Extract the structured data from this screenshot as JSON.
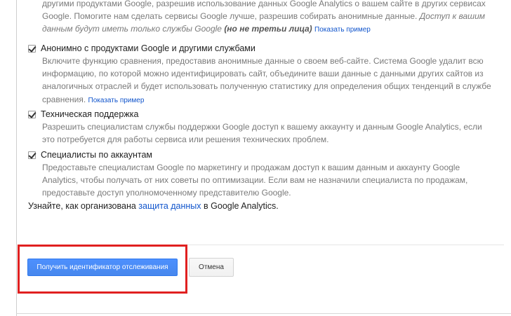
{
  "top_block": {
    "line1": "другими продуктами Google, разрешив использование данных Google Analytics о вашем сайте в других сервисах",
    "line2": "Google. Помогите нам сделать сервисы Google лучше, разрешив собирать анонимные данные.",
    "line2_italic": "Доступ к вашим",
    "line3_prefix": "данным будут иметь только службы Google",
    "line3_bold": "(но не третьи лица)",
    "example_link": "Показать пример"
  },
  "options": [
    {
      "title": "Анонимно с продуктами Google и другими службами",
      "checked": true,
      "desc_lines": [
        "Включите функцию сравнения, предоставив анонимные данные о своем веб-сайте. Система Google удалит всю",
        "информацию, по которой можно идентифицировать сайт, объедините ваши данные с данными других сайтов из",
        "аналогичных отраслей и будет использовать полученную статистику для определения общих тенденций в службе",
        "сравнения."
      ],
      "example_link": "Показать пример"
    },
    {
      "title": "Техническая поддержка",
      "checked": true,
      "desc_lines": [
        "Разрешить специалистам службы поддержки Google доступ к вашему аккаунту и данным Google Analytics, если",
        "это потребуется для работы сервиса или решения технических проблем."
      ]
    },
    {
      "title": "Специалисты по аккаунтам",
      "checked": true,
      "desc_lines": [
        "Предоставьте специалистам Google по маркетингу и продажам доступ к вашим данным и аккаунту Google",
        "Analytics, чтобы получать от них советы по оптимизации. Если вам не назначили специалиста по продажам,",
        "предоставьте доступ уполномоченному представителю Google."
      ]
    }
  ],
  "learn_more": {
    "prefix": "Узнайте, как организована",
    "link": "защита данных",
    "suffix": "в Google Analytics."
  },
  "buttons": {
    "primary": "Получить идентификатор отслеживания",
    "secondary": "Отмена"
  },
  "colors": {
    "primary_button": "#4d90fe",
    "highlight_border": "#e02020",
    "link": "#1155cc"
  }
}
